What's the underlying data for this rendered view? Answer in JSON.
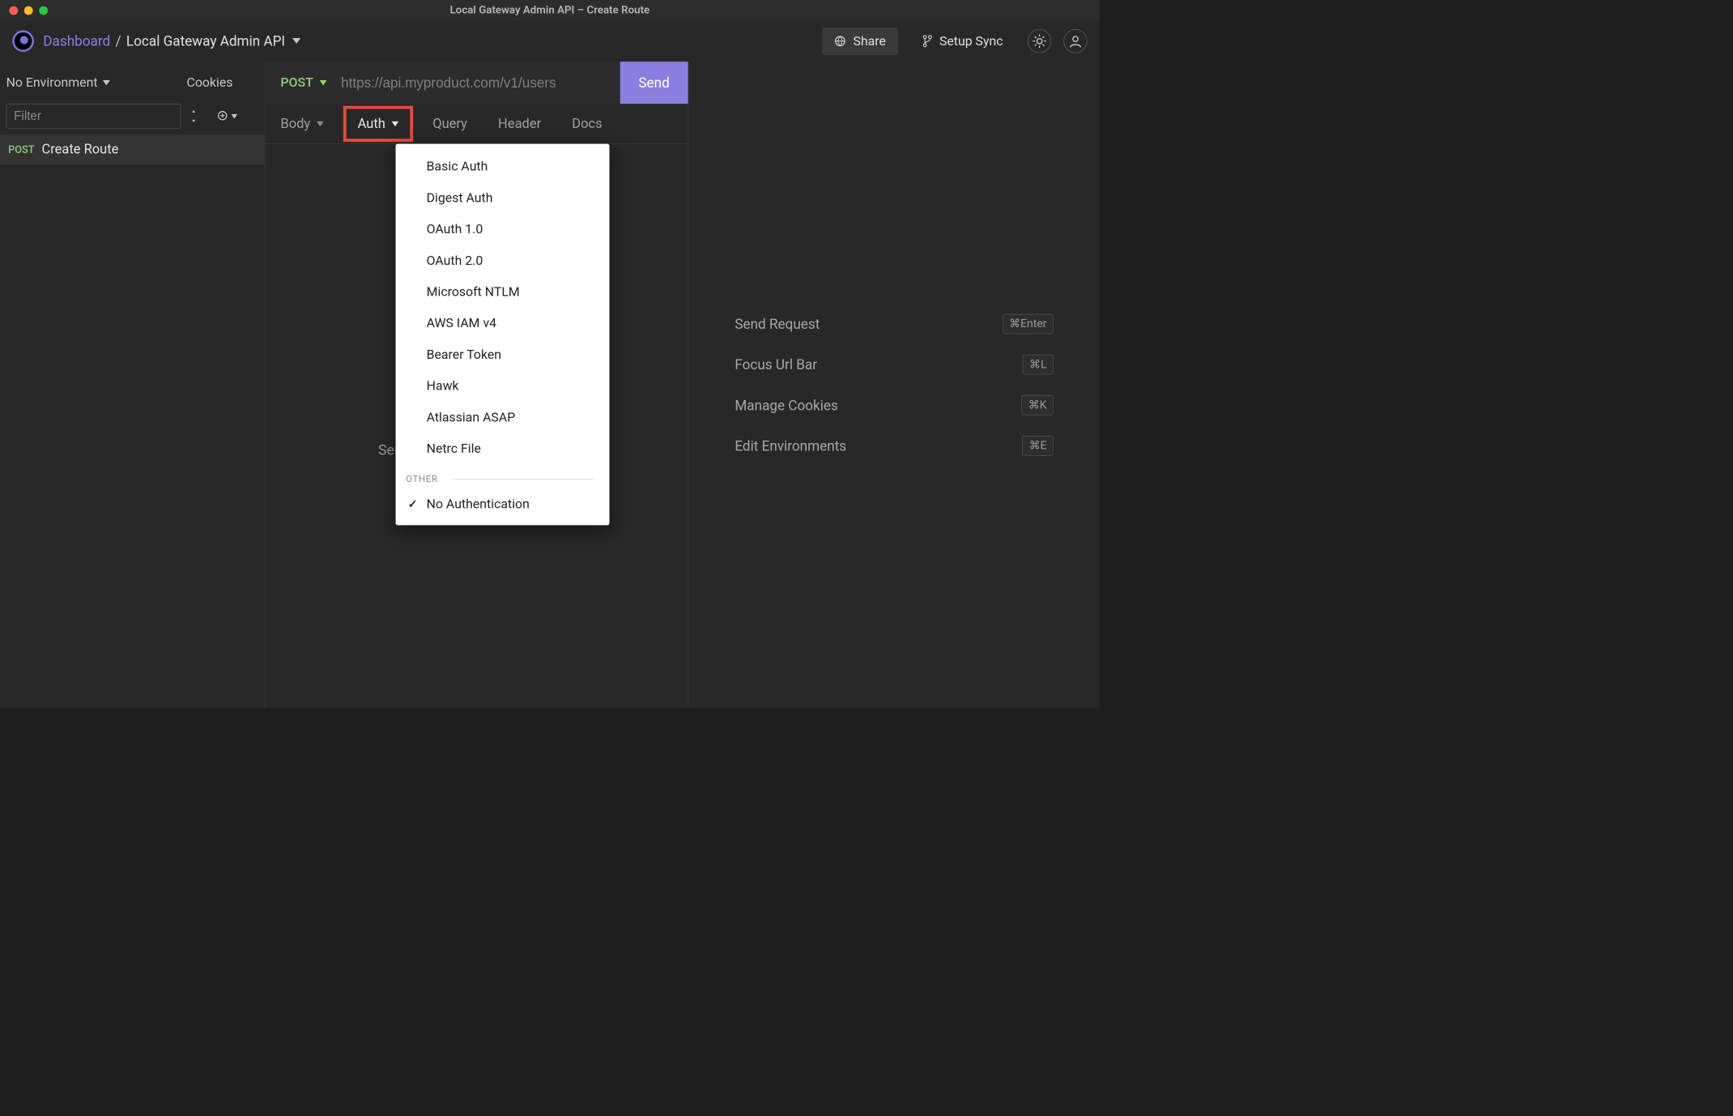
{
  "window": {
    "title": "Local Gateway Admin API – Create Route"
  },
  "header": {
    "dashboard": "Dashboard",
    "separator": "/",
    "project": "Local Gateway Admin API",
    "share": "Share",
    "setup_sync": "Setup Sync"
  },
  "sidebar": {
    "environment_label": "No Environment",
    "cookies_label": "Cookies",
    "filter_placeholder": "Filter",
    "requests": [
      {
        "method": "POST",
        "name": "Create Route"
      }
    ]
  },
  "request": {
    "method": "POST",
    "url_placeholder": "https://api.myproduct.com/v1/users",
    "url_value": "",
    "send_label": "Send",
    "tabs": {
      "body": "Body",
      "auth": "Auth",
      "query": "Query",
      "header": "Header",
      "docs": "Docs"
    },
    "body_placeholder": "Sele"
  },
  "auth_menu": {
    "items": [
      "Basic Auth",
      "Digest Auth",
      "OAuth 1.0",
      "OAuth 2.0",
      "Microsoft NTLM",
      "AWS IAM v4",
      "Bearer Token",
      "Hawk",
      "Atlassian ASAP",
      "Netrc File"
    ],
    "other_section": "OTHER",
    "no_auth": "No Authentication"
  },
  "response": {
    "shortcuts": [
      {
        "label": "Send Request",
        "key": "⌘Enter"
      },
      {
        "label": "Focus Url Bar",
        "key": "⌘L"
      },
      {
        "label": "Manage Cookies",
        "key": "⌘K"
      },
      {
        "label": "Edit Environments",
        "key": "⌘E"
      }
    ]
  }
}
